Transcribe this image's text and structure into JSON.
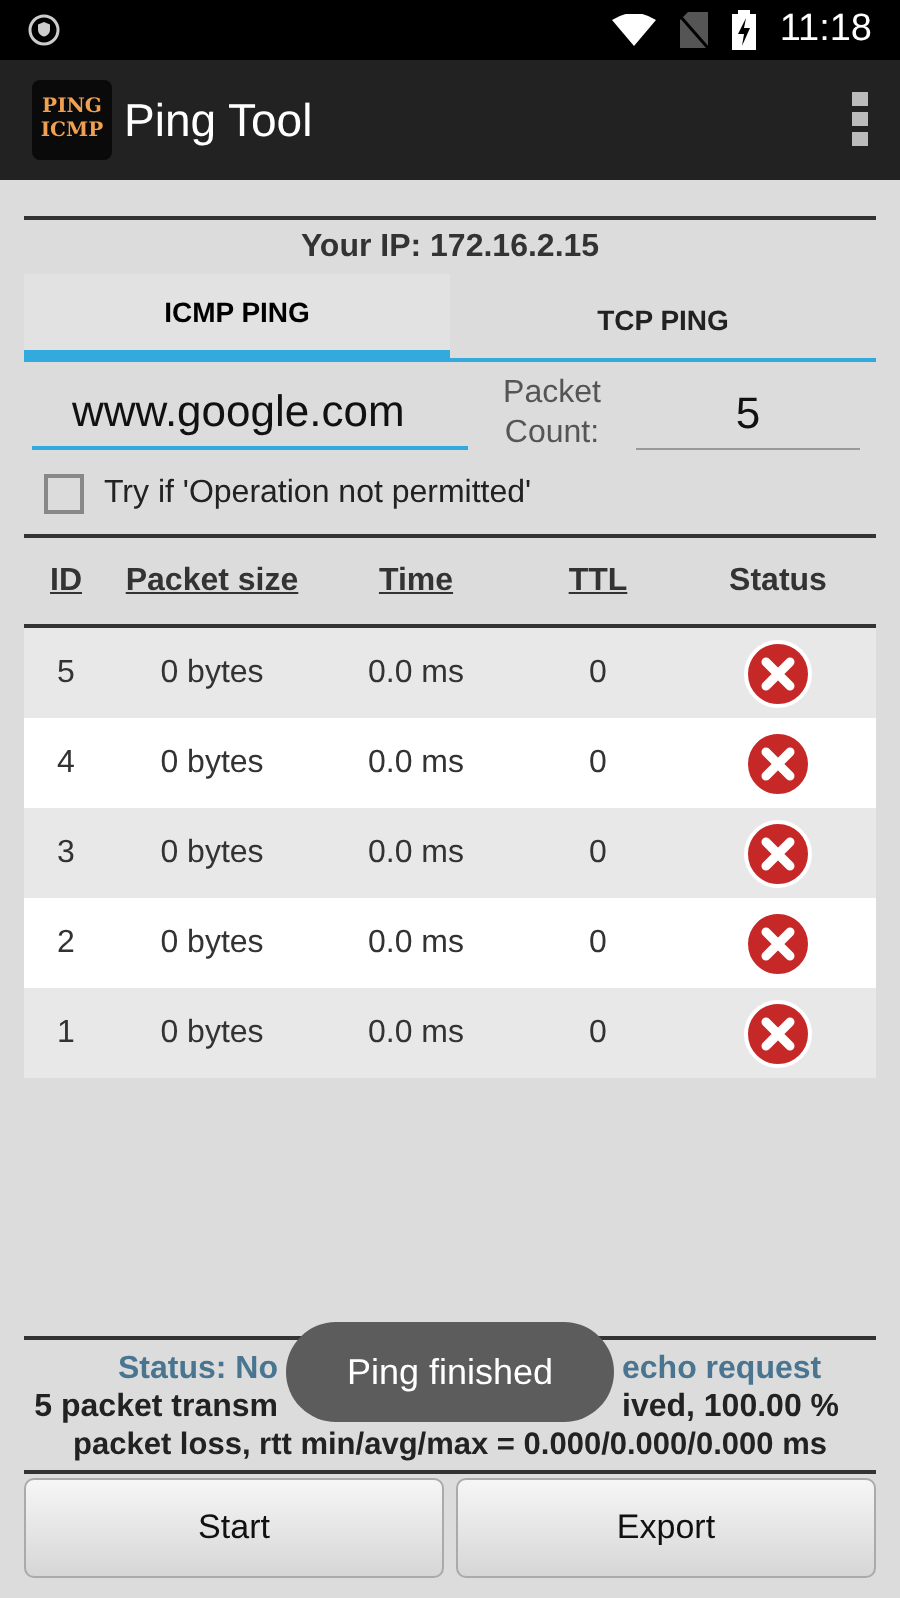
{
  "status_bar": {
    "time": "11:18"
  },
  "app_bar": {
    "title": "Ping Tool",
    "logo_lines": [
      "PING",
      "ICMP"
    ]
  },
  "ip": "Your IP: 172.16.2.15",
  "tabs": [
    {
      "label": "ICMP PING",
      "selected": true
    },
    {
      "label": "TCP PING",
      "selected": false
    }
  ],
  "host_field": {
    "value": "www.google.com"
  },
  "count_label": "Packet Count:",
  "count_field": {
    "value": "5"
  },
  "option": {
    "label": "Try if 'Operation not permitted'",
    "checked": false
  },
  "table": {
    "columns": [
      "ID",
      "Packet size",
      "Time",
      "TTL",
      "Status"
    ],
    "rows": [
      {
        "id": "5",
        "size": "0 bytes",
        "time": "0.0 ms",
        "ttl": "0",
        "ok": false
      },
      {
        "id": "4",
        "size": "0 bytes",
        "time": "0.0 ms",
        "ttl": "0",
        "ok": false
      },
      {
        "id": "3",
        "size": "0 bytes",
        "time": "0.0 ms",
        "ttl": "0",
        "ok": false
      },
      {
        "id": "2",
        "size": "0 bytes",
        "time": "0.0 ms",
        "ttl": "0",
        "ok": false
      },
      {
        "id": "1",
        "size": "0 bytes",
        "time": "0.0 ms",
        "ttl": "0",
        "ok": false
      }
    ]
  },
  "status_parts": [
    "Status: No",
    "echo request"
  ],
  "summary_parts": [
    "5 packet transm",
    "ived, 100.00 %"
  ],
  "summary_last": "packet loss, rtt min/avg/max = 0.000/0.000/0.000 ms",
  "buttons": [
    "Start",
    "Export"
  ],
  "toast": "Ping finished"
}
